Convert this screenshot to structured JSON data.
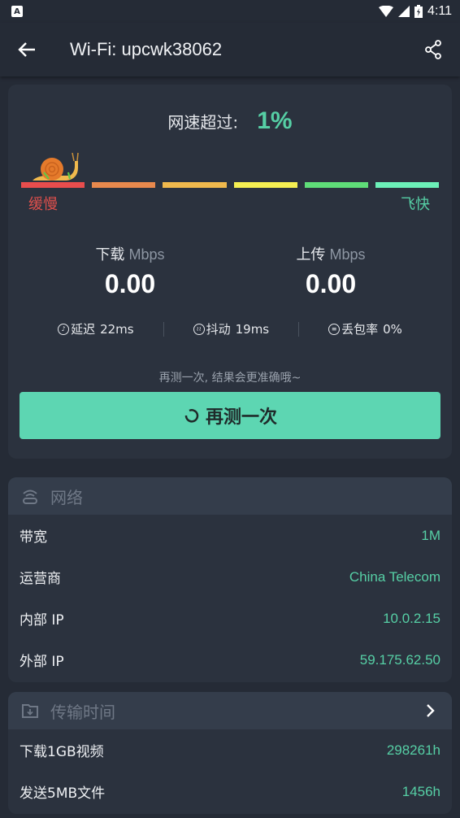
{
  "status_bar": {
    "time": "4:11",
    "left_icon": "A"
  },
  "app_bar": {
    "title": "Wi-Fi: upcwk38062",
    "back_icon": "arrow-left-icon",
    "share_icon": "share-icon"
  },
  "speed_test": {
    "rank_label": "网速超过:",
    "rank_value": "1%",
    "scale_slow": "缓慢",
    "scale_fast": "飞快",
    "scale_colors": [
      "#e84d4d",
      "#e8894d",
      "#f0b94d",
      "#f5ef52",
      "#5fdd78",
      "#6cf0b8"
    ],
    "download": {
      "label": "下载",
      "unit": "Mbps",
      "value": "0.00"
    },
    "upload": {
      "label": "上传",
      "unit": "Mbps",
      "value": "0.00"
    },
    "stats": [
      {
        "icon": "latency-icon",
        "label": "延迟",
        "value": "22ms"
      },
      {
        "icon": "jitter-icon",
        "label": "抖动",
        "value": "19ms"
      },
      {
        "icon": "packet-loss-icon",
        "label": "丢包率",
        "value": "0%"
      }
    ],
    "retest_hint": "再测一次, 结果会更准确哦~",
    "retest_button": "再测一次"
  },
  "network": {
    "title": "网络",
    "rows": [
      {
        "key": "带宽",
        "value": "1M"
      },
      {
        "key": "运营商",
        "value": "China Telecom"
      },
      {
        "key": "内部 IP",
        "value": "10.0.2.15"
      },
      {
        "key": "外部 IP",
        "value": "59.175.62.50"
      }
    ]
  },
  "transfer_time": {
    "title": "传输时间",
    "rows": [
      {
        "key": "下载1GB视频",
        "value": "298261h"
      },
      {
        "key": "发送5MB文件",
        "value": "1456h"
      }
    ]
  },
  "colors": {
    "accent": "#56cfa5",
    "background": "#252b36",
    "card": "#2b323e",
    "button": "#5dd6b2"
  }
}
